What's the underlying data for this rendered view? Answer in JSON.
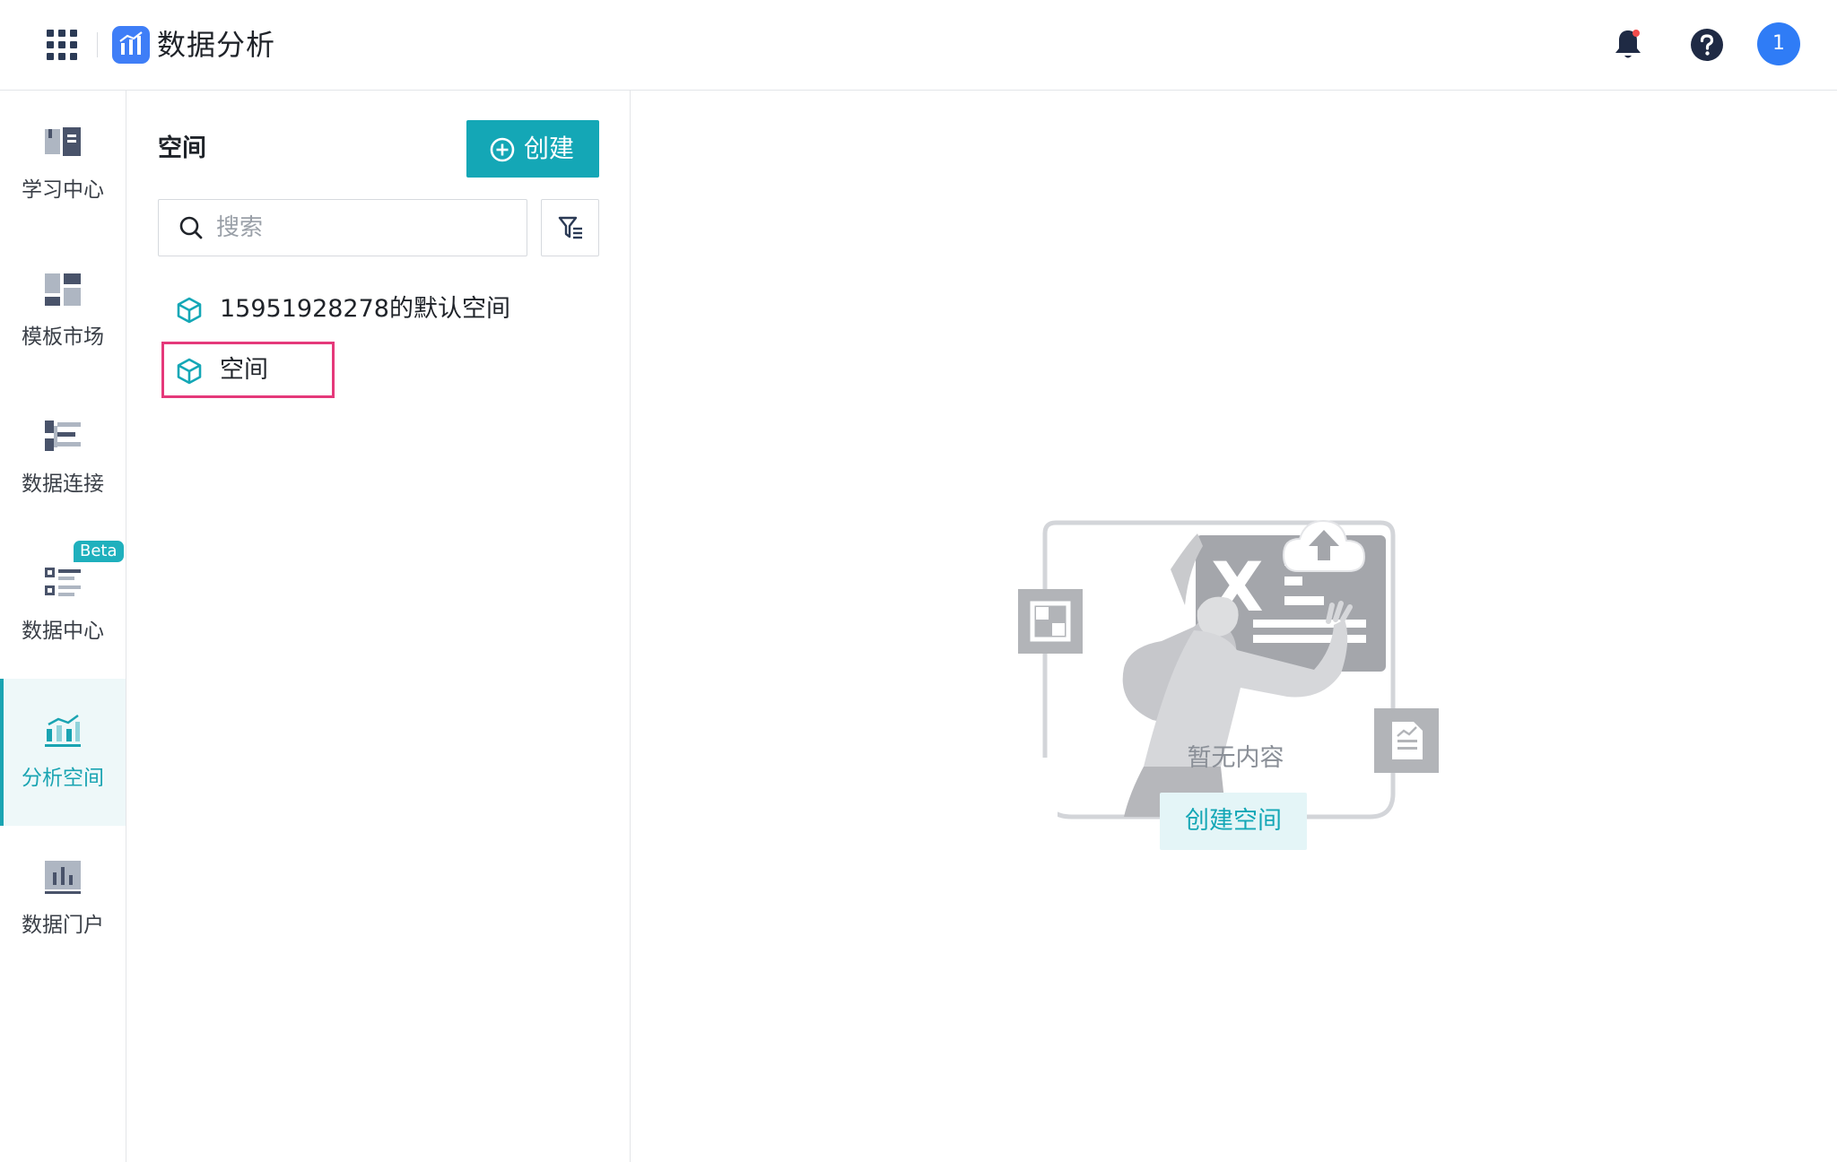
{
  "header": {
    "app_title": "数据分析",
    "apps_icon": "apps-grid-icon",
    "logo_icon": "analytics-logo-icon",
    "notification_icon": "bell-icon",
    "help_icon": "question-icon",
    "avatar_text": "1",
    "accent_color": "#3f7ef7"
  },
  "sidebar": {
    "items": [
      {
        "label": "学习中心",
        "icon": "book-icon",
        "active": false
      },
      {
        "label": "模板市场",
        "icon": "template-icon",
        "active": false
      },
      {
        "label": "数据连接",
        "icon": "data-connection-icon",
        "active": false
      },
      {
        "label": "数据中心",
        "icon": "data-center-icon",
        "active": false,
        "badge": "Beta"
      },
      {
        "label": "分析空间",
        "icon": "analysis-space-icon",
        "active": true
      },
      {
        "label": "数据门户",
        "icon": "portal-chart-icon",
        "active": false
      }
    ],
    "active_color": "#1aa4b2"
  },
  "panel": {
    "title": "空间",
    "create_label": "创建",
    "search_placeholder": "搜索",
    "filter_icon": "filter-icon",
    "spaces": [
      {
        "name": "15951928278的默认空间",
        "icon": "cube-icon"
      },
      {
        "name": "空间",
        "icon": "cube-icon",
        "highlighted": true
      }
    ]
  },
  "main": {
    "empty_text": "暂无内容",
    "create_space_label": "创建空间",
    "illustration": "empty-state-illustration"
  }
}
